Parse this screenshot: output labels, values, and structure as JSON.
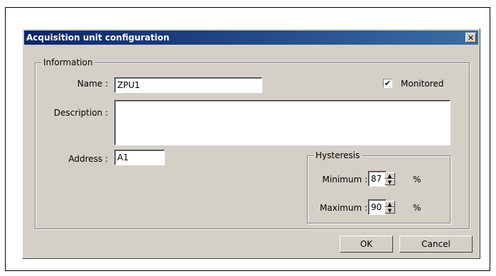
{
  "dialog": {
    "title": "Acquisition unit configuration",
    "close_glyph": "✕"
  },
  "information": {
    "legend": "Information",
    "name_label": "Name :",
    "name_value": "ZPU1",
    "monitored_label": "Monitored",
    "monitored_checked": true,
    "description_label": "Description :",
    "description_value": "",
    "address_label": "Address :",
    "address_value": "A1"
  },
  "hysteresis": {
    "legend": "Hysteresis",
    "minimum_label": "Minimum :",
    "minimum_value": "87",
    "minimum_unit": "%",
    "maximum_label": "Maximum :",
    "maximum_value": "90",
    "maximum_unit": "%"
  },
  "buttons": {
    "ok_label": "OK",
    "cancel_label": "Cancel"
  },
  "icons": {
    "check": "✔",
    "spin_up": "▲",
    "spin_down": "▼"
  }
}
